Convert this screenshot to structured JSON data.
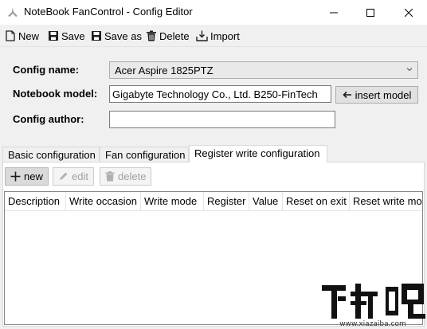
{
  "window": {
    "title": "NoteBook FanControl - Config Editor"
  },
  "toolbar": {
    "new_label": "New",
    "save_label": "Save",
    "save_as_label": "Save as",
    "delete_label": "Delete",
    "import_label": "Import"
  },
  "form": {
    "config_name_label": "Config name:",
    "config_name_value": "Acer Aspire 1825PTZ",
    "notebook_model_label": "Notebook model:",
    "notebook_model_value": "Gigabyte Technology Co., Ltd. B250-FinTech",
    "insert_model_label": "insert model",
    "config_author_label": "Config author:",
    "config_author_value": ""
  },
  "tabs": [
    {
      "label": "Basic configuration",
      "active": false
    },
    {
      "label": "Fan configuration",
      "active": false
    },
    {
      "label": "Register write configuration",
      "active": true
    }
  ],
  "actions": {
    "new_label": "new",
    "edit_label": "edit",
    "delete_label": "delete"
  },
  "grid": {
    "columns": [
      "Description",
      "Write occasion",
      "Write mode",
      "Register",
      "Value",
      "Reset on exit",
      "Reset write mod"
    ],
    "rows": []
  },
  "watermark": {
    "logo_text": "下载吧",
    "url": "www.xiazaiba.com"
  },
  "colors": {
    "toolbar_bg": "#f0f0f0",
    "panel_bg": "#f0f0f0",
    "icon_dark": "#1f1f1f",
    "disabled_text": "#a0a0a0"
  }
}
